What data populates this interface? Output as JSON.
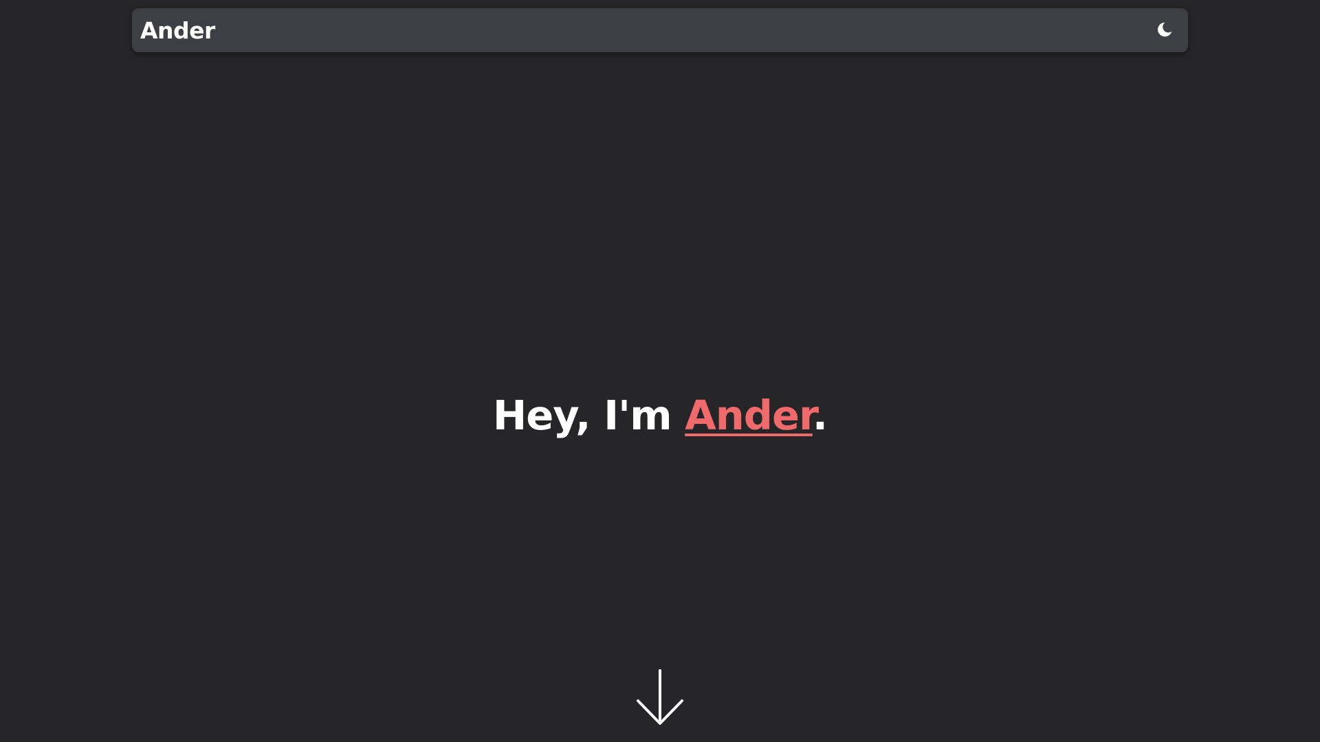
{
  "navbar": {
    "brand": "Ander",
    "theme_icon": "moon-icon"
  },
  "hero": {
    "greeting": "Hey, I'm ",
    "name": "Ander",
    "punctuation": ".",
    "accent_color": "#f0696b"
  },
  "scroll": {
    "icon": "arrow-down-icon"
  },
  "colors": {
    "background": "#262628",
    "navbar": "#3e3f44",
    "text": "#ffffff"
  }
}
